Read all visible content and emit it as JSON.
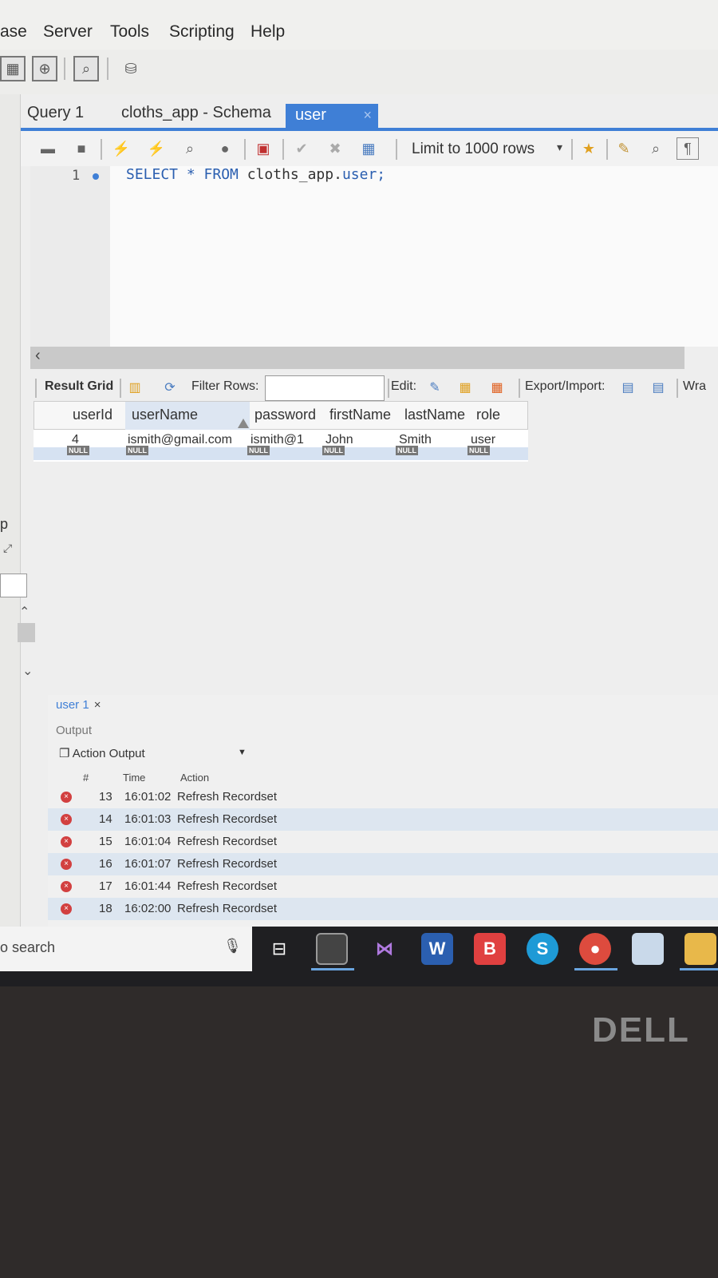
{
  "menu": [
    "ase",
    "Server",
    "Tools",
    "Scripting",
    "Help"
  ],
  "tabs": [
    {
      "label": "Query 1"
    },
    {
      "label": "cloths_app - Schema"
    },
    {
      "label": "user",
      "close": "×"
    }
  ],
  "sql_toolbar": {
    "limit_label": "Limit to 1000 rows",
    "dropdown": "▾"
  },
  "editor": {
    "line_number": "1",
    "sql_keyword": "SELECT * FROM ",
    "sql_object": "cloths_app.",
    "sql_table": "user;"
  },
  "result_toolbar": {
    "result_grid": "Result Grid",
    "filter_rows": "Filter Rows:",
    "edit": "Edit:",
    "export_import": "Export/Import:",
    "wrap": "Wra"
  },
  "grid": {
    "columns": [
      "userId",
      "userName",
      "password",
      "firstName",
      "lastName",
      "role"
    ],
    "rows": [
      [
        "4",
        "ismith@gmail.com",
        "ismith@1",
        "John",
        "Smith",
        "user"
      ]
    ],
    "null_label": "NULL"
  },
  "bottom": {
    "tab_label": "user 1",
    "tab_close": "×",
    "output_label": "Output",
    "output_select": "Action Output",
    "headers": {
      "num": "#",
      "time": "Time",
      "action": "Action"
    },
    "rows": [
      {
        "n": "13",
        "time": "16:01:02",
        "action": "Refresh Recordset"
      },
      {
        "n": "14",
        "time": "16:01:03",
        "action": "Refresh Recordset"
      },
      {
        "n": "15",
        "time": "16:01:04",
        "action": "Refresh Recordset"
      },
      {
        "n": "16",
        "time": "16:01:07",
        "action": "Refresh Recordset"
      },
      {
        "n": "17",
        "time": "16:01:44",
        "action": "Refresh Recordset"
      },
      {
        "n": "18",
        "time": "16:02:00",
        "action": "Refresh Recordset"
      }
    ]
  },
  "taskbar": {
    "search_text": "o search"
  },
  "laptop": {
    "brand": "DELL"
  },
  "left_panel": {
    "letter": "p"
  },
  "colors": {
    "accent": "#3f7fd6",
    "error": "#d24040"
  }
}
